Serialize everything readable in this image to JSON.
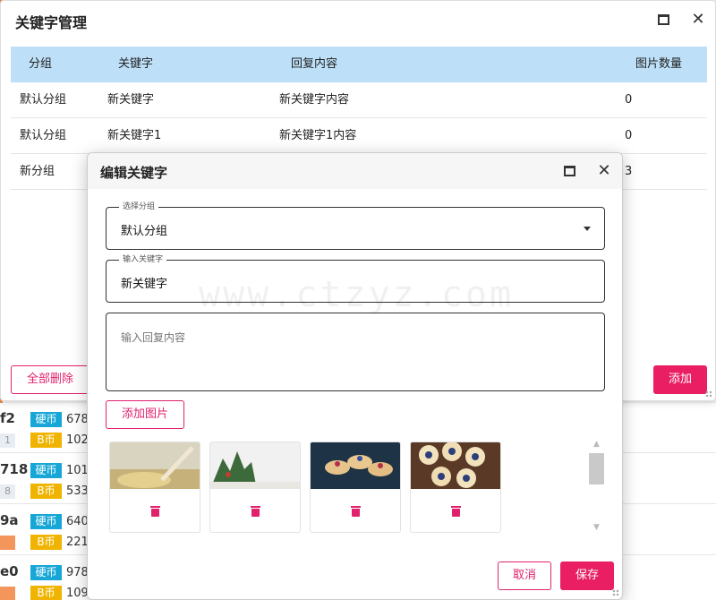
{
  "main_dialog": {
    "title": "关键字管理",
    "columns": [
      "分组",
      "关键字",
      "回复内容",
      "图片数量"
    ],
    "rows": [
      {
        "group": "默认分组",
        "keyword": "新关键字",
        "reply": "新关键字内容",
        "count": "0"
      },
      {
        "group": "默认分组",
        "keyword": "新关键字1",
        "reply": "新关键字1内容",
        "count": "0"
      },
      {
        "group": "新分组",
        "keyword": "",
        "reply": "",
        "count": "3"
      }
    ],
    "delete_all_label": "全部删除",
    "add_label": "添加"
  },
  "edit_dialog": {
    "title": "编辑关键字",
    "group_field": {
      "legend": "选择分组",
      "value": "默认分组"
    },
    "keyword_field": {
      "legend": "输入关键字",
      "value": "新关键字"
    },
    "reply_field": {
      "placeholder": "输入回复内容"
    },
    "add_image_label": "添加图片",
    "image_count": 4,
    "cancel_label": "取消",
    "save_label": "保存"
  },
  "watermark": "www.ctzyz.com",
  "background_list": [
    {
      "hash": "f2",
      "tag": "1",
      "hard_label": "硬币",
      "hard_value": "678",
      "b_label": "B币",
      "b_value": "102"
    },
    {
      "hash": "718",
      "tag": "8",
      "hard_label": "硬币",
      "hard_value": "101",
      "b_label": "B币",
      "b_value": "533"
    },
    {
      "hash": "9a",
      "tag": "",
      "hard_label": "硬币",
      "hard_value": "640",
      "b_label": "B币",
      "b_value": "221"
    },
    {
      "hash": "e0",
      "tag": "",
      "hard_label": "硬币",
      "hard_value": "978",
      "b_label": "B币",
      "b_value": "109"
    }
  ],
  "colors": {
    "accent": "#e91e63",
    "table_header": "#bde0f8",
    "hard_coin": "#17a7d7",
    "b_coin": "#f0b400"
  }
}
